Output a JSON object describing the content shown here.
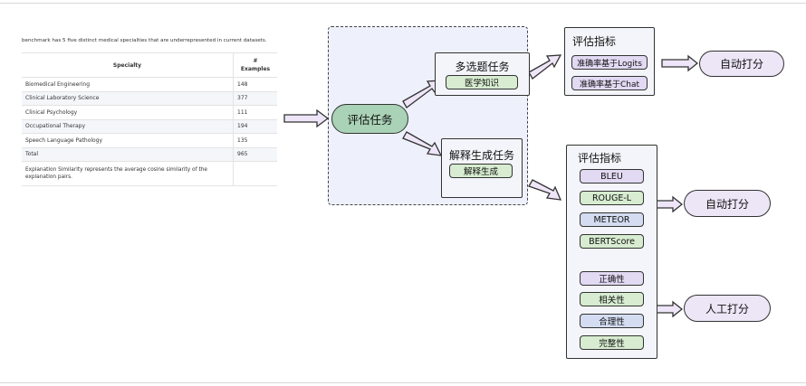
{
  "table_panel": {
    "caption": "benchmark has 5 five distinct medical specialties that are underrepresented in current datasets.",
    "header_specialty": "Specialty",
    "header_examples_line1": "#",
    "header_examples_line2": "Examples",
    "rows": [
      {
        "specialty": "Biomedical Engineering",
        "examples": "148"
      },
      {
        "specialty": "Clinical Laboratory Science",
        "examples": "377"
      },
      {
        "specialty": "Clinical Psychology",
        "examples": "111"
      },
      {
        "specialty": "Occupational Therapy",
        "examples": "194"
      },
      {
        "specialty": "Speech Language Pathology",
        "examples": "135"
      },
      {
        "specialty": "Total",
        "examples": "965"
      }
    ],
    "footnote": "Explanation Similarity represents the average cosine similarity of the explanation pairs."
  },
  "diagram": {
    "eval_task": "评估任务",
    "mcq_task": "多选题任务",
    "mcq_sub": "医学知识",
    "gen_task": "解释生成任务",
    "gen_sub": "解释生成",
    "metrics_top_title": "评估指标",
    "metrics_top": [
      "准确率基于Logits",
      "准确率基于Chat"
    ],
    "auto_score_top": "自动打分",
    "metrics_bottom_title": "评估指标",
    "metrics_auto": [
      "BLEU",
      "ROUGE-L",
      "METEOR",
      "BERTScore"
    ],
    "auto_score_bottom": "自动打分",
    "metrics_human": [
      "正确性",
      "相关性",
      "合理性",
      "完整性"
    ],
    "human_score": "人工打分"
  },
  "colors": {
    "green": "#d7ecd0",
    "purple": "#e2d9f3",
    "blue": "#d3dcf0",
    "eval_oval": "#a9d2b6",
    "score_oval": "#ece6f7",
    "arrow_fill": "#eee6f8"
  }
}
